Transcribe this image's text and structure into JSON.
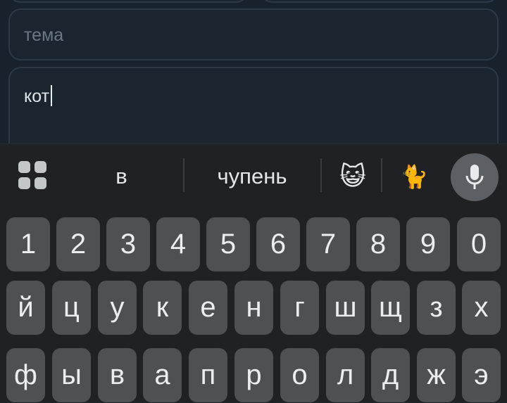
{
  "compose": {
    "subject_placeholder": "тема",
    "body_text": "кот"
  },
  "keyboard": {
    "suggestions": [
      "в",
      "чупень"
    ],
    "emoji_suggestions": [
      "😺",
      "🐈"
    ],
    "number_row": [
      "1",
      "2",
      "3",
      "4",
      "5",
      "6",
      "7",
      "8",
      "9",
      "0"
    ],
    "row1": [
      "й",
      "ц",
      "у",
      "к",
      "е",
      "н",
      "г",
      "ш",
      "щ",
      "з",
      "х"
    ],
    "row2": [
      "ф",
      "ы",
      "в",
      "а",
      "п",
      "р",
      "о",
      "л",
      "д",
      "ж",
      "э"
    ]
  },
  "icons": {
    "apps": "apps-grid-icon",
    "mic": "microphone-icon"
  },
  "colors": {
    "app_background": "#18222d",
    "keyboard_background": "#202124",
    "key_background": "#4e5053",
    "mic_button": "#5c5f64"
  }
}
